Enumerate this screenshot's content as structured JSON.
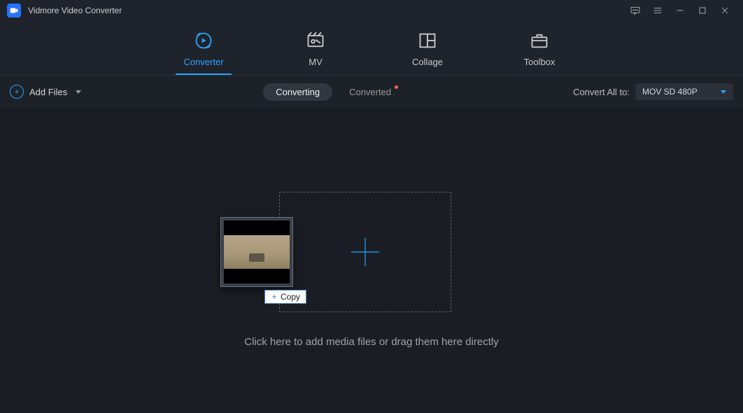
{
  "app": {
    "title": "Vidmore Video Converter"
  },
  "nav": {
    "items": [
      {
        "label": "Converter"
      },
      {
        "label": "MV"
      },
      {
        "label": "Collage"
      },
      {
        "label": "Toolbox"
      }
    ]
  },
  "toolbar": {
    "add_files_label": "Add Files",
    "converting_label": "Converting",
    "converted_label": "Converted",
    "convert_all_label": "Convert All to:",
    "format_selected": "MOV SD 480P"
  },
  "stage": {
    "hint": "Click here to add media files or drag them here directly",
    "copy_badge": "Copy"
  }
}
